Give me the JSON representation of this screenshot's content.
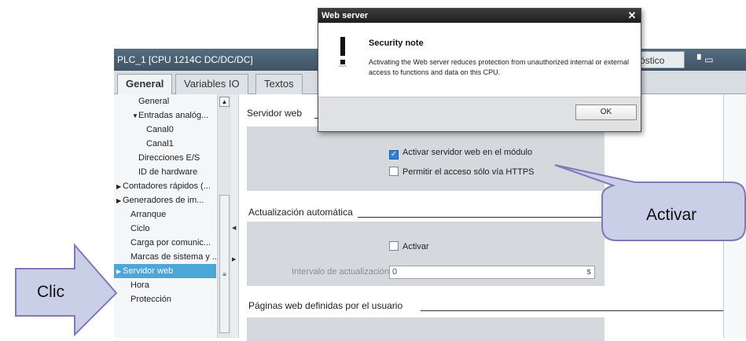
{
  "window": {
    "title": "PLC_1 [CPU 1214C DC/DC/DC]",
    "diagnostics_tab": "óstico",
    "window_buttons": "▘▭"
  },
  "tabs": [
    {
      "label": "General",
      "active": true
    },
    {
      "label": "Variables IO",
      "active": false
    },
    {
      "label": "Textos",
      "active": false
    }
  ],
  "tree": {
    "items": [
      {
        "label": "General",
        "indent": 2,
        "caret": ""
      },
      {
        "label": "Entradas analóg...",
        "indent": 2,
        "caret": "▼"
      },
      {
        "label": "Canal0",
        "indent": 3,
        "caret": ""
      },
      {
        "label": "Canal1",
        "indent": 3,
        "caret": ""
      },
      {
        "label": "Direcciones E/S",
        "indent": 2,
        "caret": ""
      },
      {
        "label": "ID de hardware",
        "indent": 2,
        "caret": ""
      },
      {
        "label": "Contadores rápidos (...",
        "indent": 0,
        "caret": "▶"
      },
      {
        "label": "Generadores de im...",
        "indent": 0,
        "caret": "▶"
      },
      {
        "label": "Arranque",
        "indent": 1,
        "caret": ""
      },
      {
        "label": "Ciclo",
        "indent": 1,
        "caret": ""
      },
      {
        "label": "Carga por comunic...",
        "indent": 1,
        "caret": ""
      },
      {
        "label": "Marcas de sistema y ...",
        "indent": 1,
        "caret": ""
      },
      {
        "label": "Servidor web",
        "indent": 0,
        "caret": "▶",
        "selected": true
      },
      {
        "label": "Hora",
        "indent": 1,
        "caret": ""
      },
      {
        "label": "Protección",
        "indent": 1,
        "caret": ""
      }
    ]
  },
  "sections": {
    "webserver": {
      "title": "Servidor web",
      "enable_label": "Activar servidor web en el módulo",
      "enable_checked": true,
      "https_label": "Permitir el acceso sólo vía HTTPS",
      "https_checked": false
    },
    "auto_update": {
      "title": "Actualización automática",
      "activate_label": "Activar",
      "activate_checked": false,
      "interval_label": "Intervalo de actualización:",
      "interval_value": "0",
      "interval_unit": "s"
    },
    "user_pages": {
      "title": "Páginas web definidas por el usuario"
    }
  },
  "dialog": {
    "title": "Web server",
    "heading": "Security note",
    "message": "Activating the Web server reduces protection from unauthorized internal or external access to functions and data on this CPU.",
    "ok_label": "OK",
    "close_glyph": "✕"
  },
  "callouts": {
    "activar": "Activar",
    "clic": "Clic"
  },
  "colors": {
    "callout_fill": "#c9cfe6",
    "callout_border": "#8277b8",
    "arrow_fill": "#c9cfe6",
    "selected_bg": "#4da6d8",
    "titlebar": "#4a5f72"
  }
}
